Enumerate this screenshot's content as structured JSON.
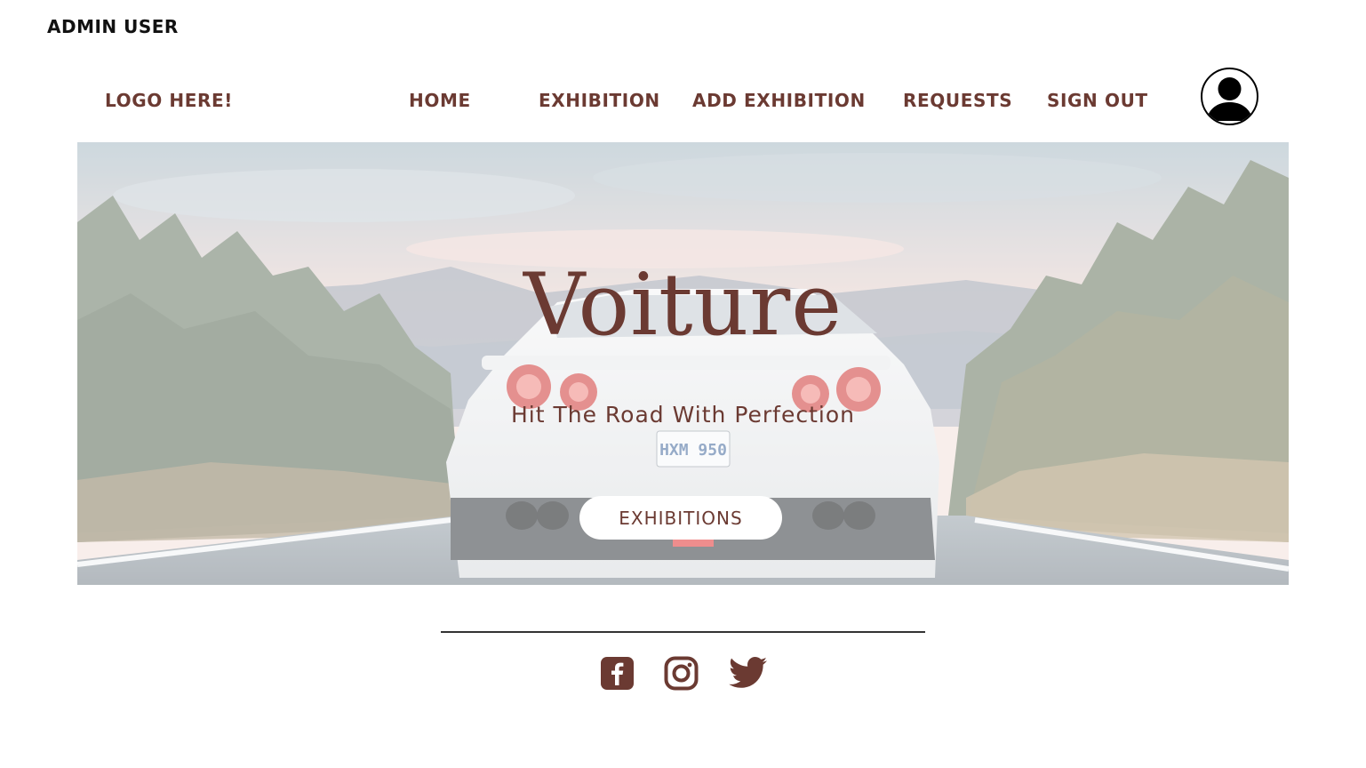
{
  "header": {
    "user_label": "ADMIN USER",
    "logo_text": "LOGO HERE!"
  },
  "nav": {
    "home": "HOME",
    "exhibition": "EXHIBITION",
    "add_exhibition": "ADD EXHIBITION",
    "requests": "REQUESTS",
    "sign_out": "SIGN OUT",
    "profile_icon": "user-avatar-icon"
  },
  "hero": {
    "title": "Voiture",
    "subtitle": "Hit The Road With Perfection",
    "button_label": "EXHIBITIONS",
    "plate_text": "HXM 950",
    "image_subject": "white sports car on forest road"
  },
  "footer": {
    "social": [
      {
        "icon": "facebook-icon"
      },
      {
        "icon": "instagram-icon"
      },
      {
        "icon": "twitter-icon"
      }
    ]
  },
  "colors": {
    "accent": "#6b3a32",
    "text_dark": "#111111",
    "background": "#ffffff"
  }
}
